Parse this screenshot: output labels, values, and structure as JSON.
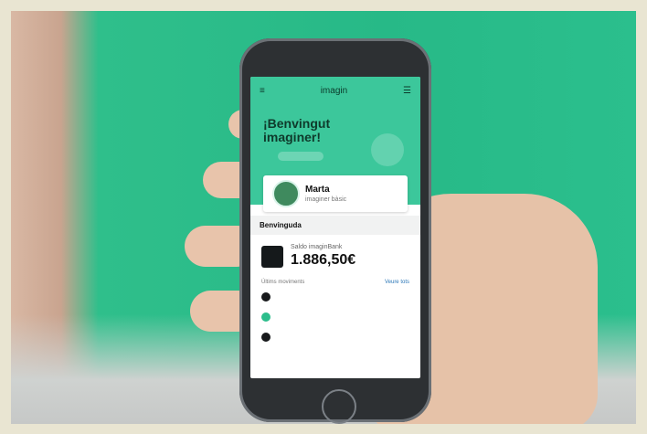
{
  "screen": {
    "status": {
      "left": "",
      "center": "",
      "right": ""
    },
    "nav": {
      "menu": "≡",
      "brand": "imagin",
      "profile": "☰"
    },
    "welcome": "¡Benvingut imaginer!",
    "profile": {
      "name": "Marta",
      "subtitle": "imaginer bàsic"
    },
    "section_title": "Benvinguda",
    "balance": {
      "label": "Saldo imaginBank",
      "value": "1.886,50€"
    },
    "list": {
      "header_left": "Últims moviments",
      "header_right": "Veure tots",
      "items": [
        {
          "title": "",
          "subtitle": "",
          "amount": ""
        },
        {
          "title": "",
          "subtitle": "",
          "amount": ""
        },
        {
          "title": "",
          "subtitle": "",
          "amount": ""
        }
      ]
    }
  },
  "colors": {
    "background_green": "#2bbf8d",
    "app_green": "#3cc79b",
    "phone": "#2d3033"
  },
  "icons": {
    "menu": "menu-icon",
    "profile": "profile-icon"
  }
}
